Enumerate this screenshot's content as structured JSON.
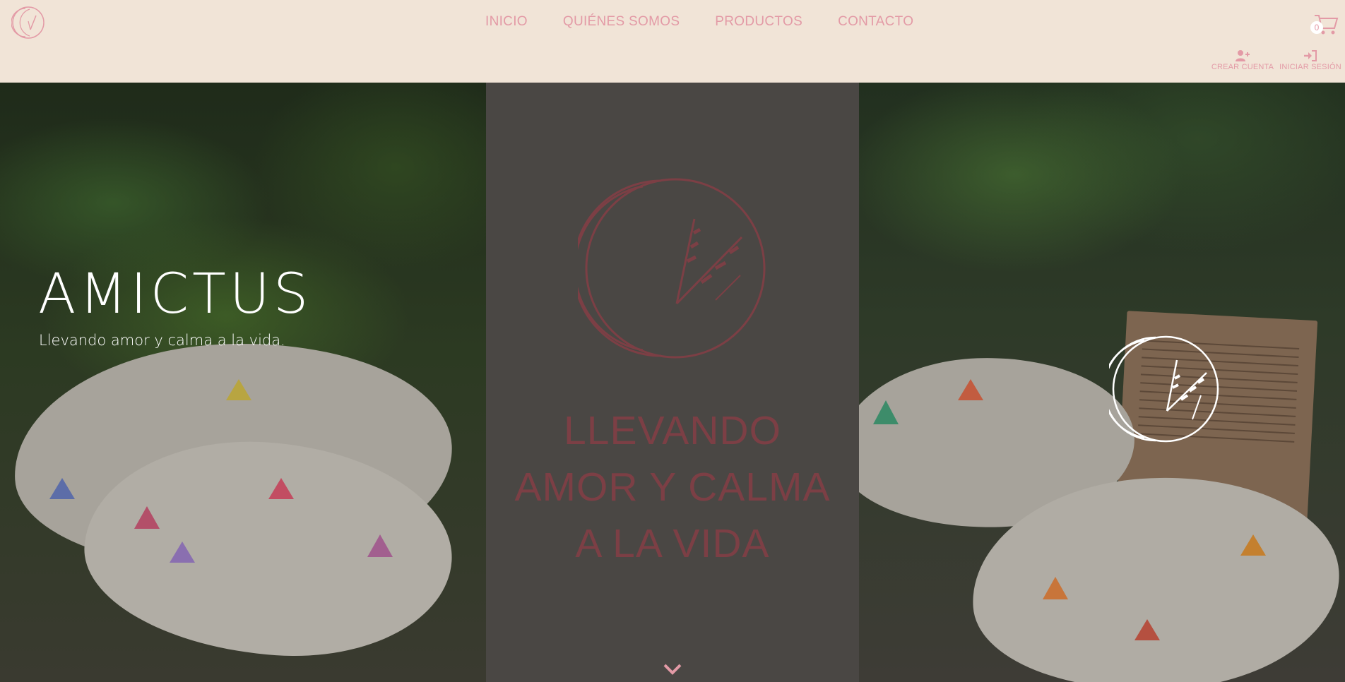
{
  "header": {
    "logo_icon": "amictus-crescent-wheat-logo",
    "nav": [
      {
        "label": "INICIO"
      },
      {
        "label": "QUIÉNES SOMOS"
      },
      {
        "label": "PRODUCTOS"
      },
      {
        "label": "CONTACTO"
      }
    ],
    "cart": {
      "icon": "cart-icon",
      "count": "0"
    },
    "account": {
      "create_label": "CREAR CUENTA",
      "create_icon": "user-plus-icon",
      "login_label": "INICIAR SESIÓN",
      "login_icon": "sign-in-icon"
    }
  },
  "hero": {
    "brand": "AMICTUS",
    "tagline": "Llevando amor y calma a la vida.",
    "center_lines": [
      "LLEVANDO",
      "AMOR Y CALMA",
      "A LA VIDA"
    ],
    "scroll_icon": "chevron-down-icon"
  },
  "colors": {
    "header_bg": "#f1e4d7",
    "accent_pink": "#e39aa6",
    "center_text": "#7c3f45"
  }
}
